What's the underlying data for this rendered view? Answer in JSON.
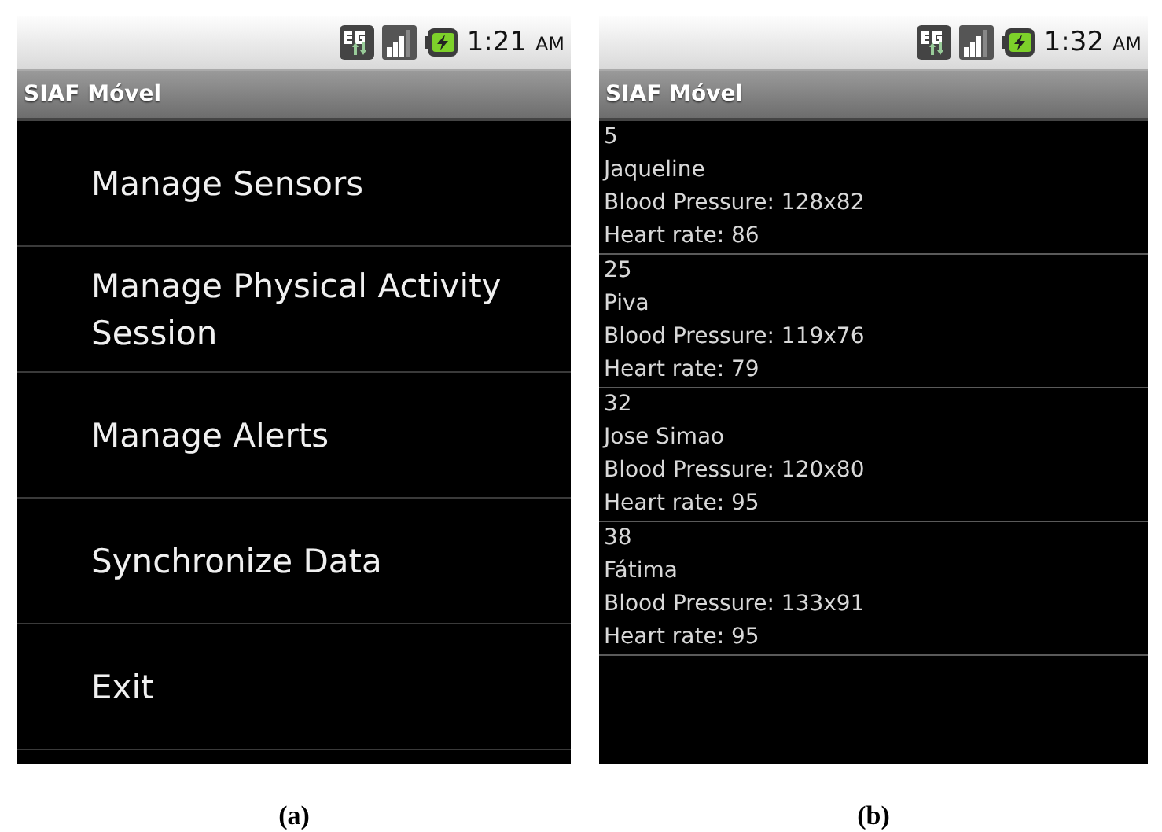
{
  "panels": [
    {
      "kind": "menu",
      "status_bar": {
        "time": "1:21",
        "ampm": "AM"
      },
      "app_title": "SIAF Móvel",
      "caption": "(a)",
      "items": [
        "Manage Sensors",
        "Manage Physical Activity Session",
        "Manage Alerts",
        "Synchronize Data",
        "Exit"
      ]
    },
    {
      "kind": "records",
      "status_bar": {
        "time": "1:32",
        "ampm": "AM"
      },
      "app_title": "SIAF Móvel",
      "caption": "(b)",
      "records": [
        {
          "id": "5",
          "name": "Jaqueline",
          "blood_pressure": "Blood Pressure: 128x82",
          "heart_rate": "Heart rate: 86"
        },
        {
          "id": "25",
          "name": "Piva",
          "blood_pressure": "Blood Pressure: 119x76",
          "heart_rate": "Heart rate: 79"
        },
        {
          "id": "32",
          "name": "Jose Simao",
          "blood_pressure": "Blood Pressure: 120x80",
          "heart_rate": "Heart rate: 95"
        },
        {
          "id": "38",
          "name": "Fátima",
          "blood_pressure": "Blood Pressure: 133x91",
          "heart_rate": "Heart rate: 95"
        }
      ]
    }
  ]
}
